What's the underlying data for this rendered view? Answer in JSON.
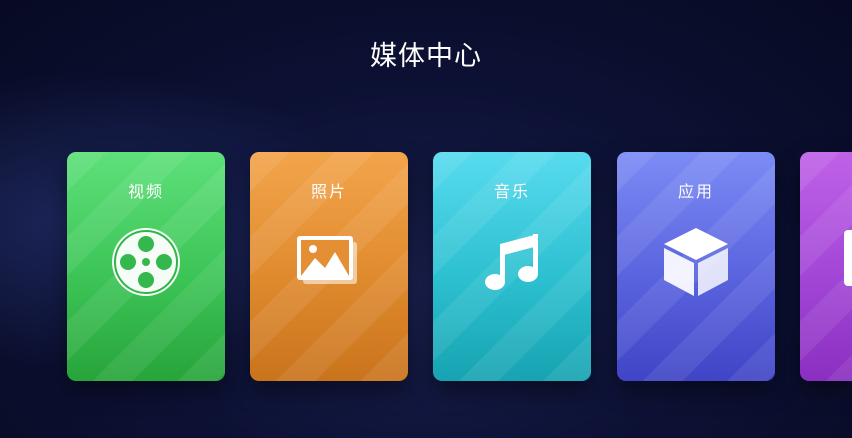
{
  "header": {
    "title": "媒体中心"
  },
  "tiles": [
    {
      "label": "视频",
      "icon": "film-reel-icon",
      "color_top": "#5ee07a",
      "color_bottom": "#27a43a"
    },
    {
      "label": "照片",
      "icon": "photo-gallery-icon",
      "color_top": "#f3a54c",
      "color_bottom": "#c9731c"
    },
    {
      "label": "音乐",
      "icon": "music-note-icon",
      "color_top": "#58dbef",
      "color_bottom": "#17a3b1"
    },
    {
      "label": "应用",
      "icon": "app-cube-icon",
      "color_top": "#7c8cf5",
      "color_bottom": "#3f45c6"
    },
    {
      "label": "",
      "icon": "partial-tile",
      "color_top": "#c062e8",
      "color_bottom": "#8a2fbf"
    }
  ]
}
